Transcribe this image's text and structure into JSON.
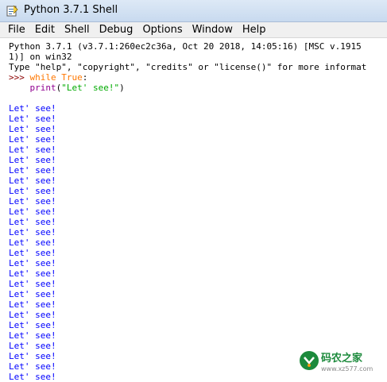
{
  "window": {
    "title": "Python 3.7.1 Shell",
    "icon": "python-idle-icon"
  },
  "menu": [
    "File",
    "Edit",
    "Shell",
    "Debug",
    "Options",
    "Window",
    "Help"
  ],
  "shell": {
    "banner_line1": "Python 3.7.1 (v3.7.1:260ec2c36a, Oct 20 2018, 14:05:16) [MSC v.1915",
    "banner_line2": "1)] on win32",
    "banner_line3": "Type \"help\", \"copyright\", \"credits\" or \"license()\" for more informat",
    "prompt": ">>>",
    "code_kw1": "while",
    "code_kw2": "True",
    "code_colon": ":",
    "code_indent": "    ",
    "code_fn": "print",
    "code_paren_open": "(",
    "code_string": "\"Let' see!\"",
    "code_paren_close": ")",
    "output_text": "Let' see!",
    "output_lines": [
      "Let' see!",
      "Let' see!",
      "Let' see!",
      "Let' see!",
      "Let' see!",
      "Let' see!",
      "Let' see!",
      "Let' see!",
      "Let' see!",
      "Let' see!",
      "Let' see!",
      "Let' see!",
      "Let' see!",
      "Let' see!",
      "Let' see!",
      "Let' see!",
      "Let' see!",
      "Let' see!",
      "Let' see!",
      "Let' see!",
      "Let' see!",
      "Let' see!",
      "Let' see!",
      "Let' see!",
      "Let' see!",
      "Let' see!",
      "Let' see!"
    ]
  },
  "watermark": {
    "name": "码农之家",
    "url": "www.xz577.com"
  },
  "colors": {
    "prompt": "#8b0000",
    "keyword": "#ff7700",
    "builtin": "#900090",
    "string": "#00aa00",
    "output": "#0000ff"
  }
}
